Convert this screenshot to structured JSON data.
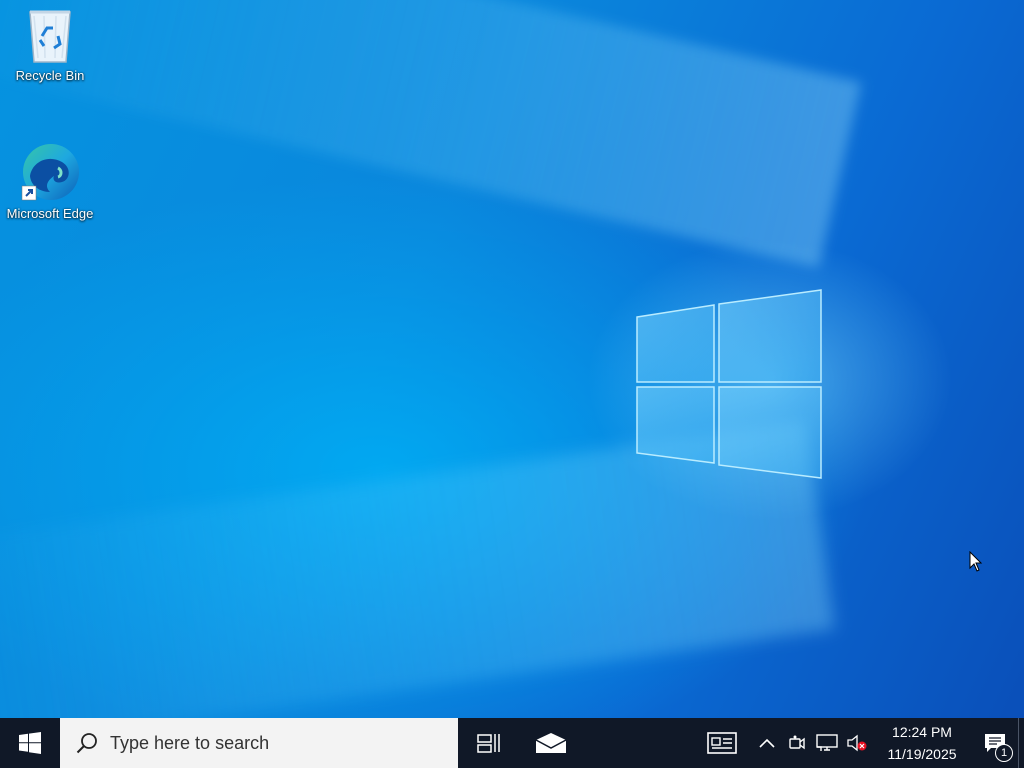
{
  "desktop": {
    "icons": [
      {
        "label": "Recycle Bin",
        "icon": "recycle-bin-icon"
      },
      {
        "label": "Microsoft Edge",
        "icon": "edge-icon"
      }
    ]
  },
  "taskbar": {
    "start_icon": "windows-icon",
    "search": {
      "placeholder": "Type here to search",
      "icon": "search-icon"
    },
    "task_view_icon": "task-view-icon",
    "mail_icon": "mail-icon",
    "news_icon": "news-icon",
    "tray": {
      "chevron_icon": "chevron-up-icon",
      "meet_icon": "meet-now-icon",
      "network_icon": "network-icon",
      "volume_icon": "volume-muted-icon"
    },
    "clock": {
      "time": "12:24 PM",
      "date": "11/19/2025"
    },
    "notifications": {
      "count": "1",
      "icon": "notification-icon"
    }
  },
  "colors": {
    "wallpaper": "#0a86dc",
    "taskbar": "#101827",
    "search_box": "#f3f3f3"
  }
}
